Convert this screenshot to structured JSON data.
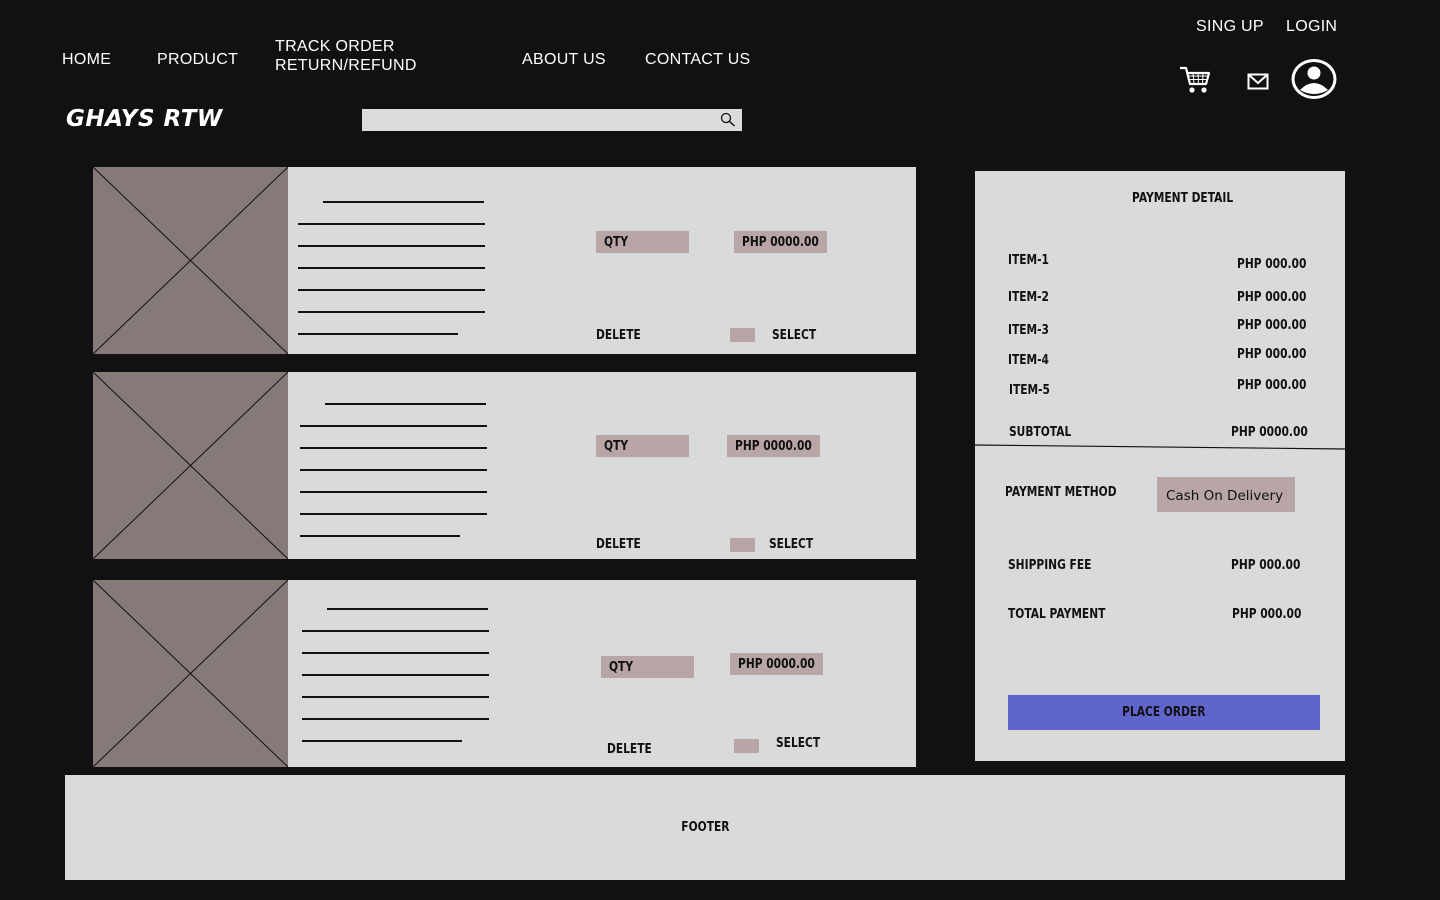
{
  "auth": {
    "signup": "SING UP",
    "login": "LOGIN"
  },
  "nav": {
    "home": "HOME",
    "product": "PRODUCT",
    "track_line1": "TRACK ORDER",
    "track_line2": "RETURN/REFUND",
    "about": "ABOUT US",
    "contact": "CONTACT US"
  },
  "brand": {
    "logo": "GHAYS RTW"
  },
  "search": {
    "placeholder": "",
    "icon": "magnifier-icon"
  },
  "header_icons": [
    "cart-icon",
    "mail-icon",
    "user-avatar-icon"
  ],
  "cart_items": [
    {
      "qty_label": "QTY",
      "price": "PHP 0000.00",
      "delete_label": "DELETE",
      "select_label": "SELECT"
    },
    {
      "qty_label": "QTY",
      "price": "PHP 0000.00",
      "delete_label": "DELETE",
      "select_label": "SELECT"
    },
    {
      "qty_label": "QTY",
      "price": "PHP 0000.00",
      "delete_label": "DELETE",
      "select_label": "SELECT"
    }
  ],
  "payment": {
    "title": "PAYMENT DETAIL",
    "items": [
      {
        "label": "ITEM-1",
        "amount": "PHP 000.00"
      },
      {
        "label": "ITEM-2",
        "amount": "PHP 000.00"
      },
      {
        "label": "ITEM-3",
        "amount": "PHP 000.00"
      },
      {
        "label": "ITEM-4",
        "amount": "PHP 000.00"
      },
      {
        "label": "ITEM-5",
        "amount": "PHP 000.00"
      }
    ],
    "subtotal_label": "SUBTOTAL",
    "subtotal_amount": "PHP 0000.00",
    "method_label": "PAYMENT METHOD",
    "method_value": "Cash On Delivery",
    "shipping_label": "SHIPPING FEE",
    "shipping_amount": "PHP 000.00",
    "total_label": "TOTAL PAYMENT",
    "total_amount": "PHP 000.00",
    "place_order": "PLACE ORDER"
  },
  "footer": {
    "label": "FOOTER"
  },
  "colors": {
    "background": "#111111",
    "card": "#dadada",
    "thumbnail": "#857a78",
    "chip": "#b8a6a6",
    "primary_button": "#6065cc"
  }
}
